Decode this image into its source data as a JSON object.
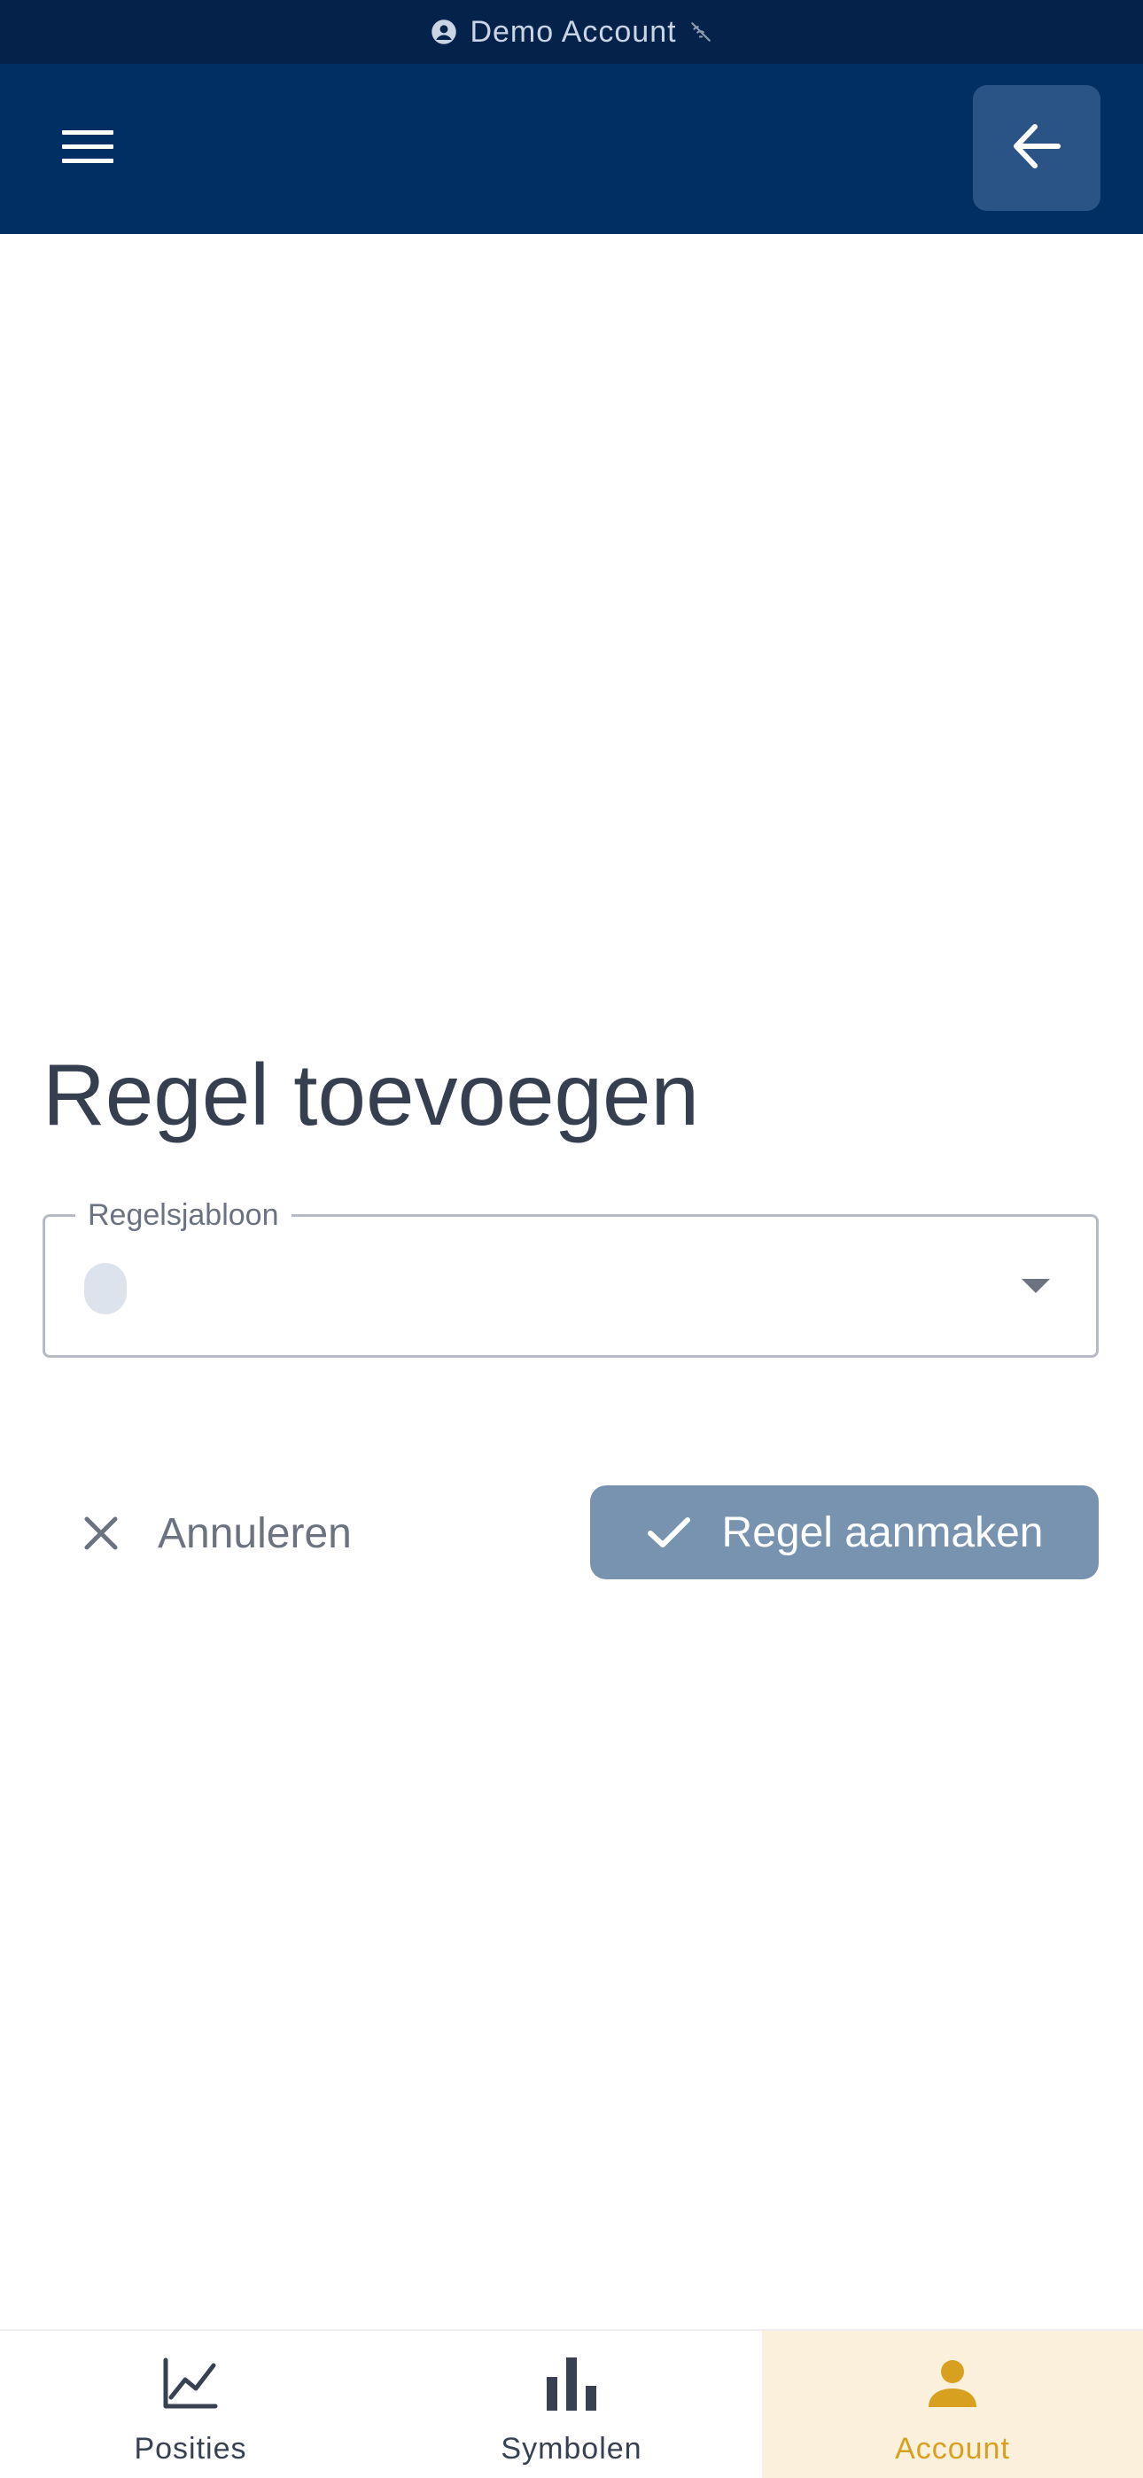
{
  "status_bar": {
    "account_label": "Demo Account",
    "account_icon": "account-circle-icon",
    "status_icon": "wifi-off-icon"
  },
  "header": {
    "menu_icon": "hamburger-menu-icon",
    "back_icon": "arrow-left-icon"
  },
  "form": {
    "title": "Regel toevoegen",
    "template_field": {
      "label": "Regelsjabloon",
      "value": "",
      "dropdown_icon": "caret-down-icon"
    },
    "cancel_label": "Annuleren",
    "create_label": "Regel aanmaken"
  },
  "bottom_nav": {
    "items": [
      {
        "label": "Posities",
        "icon": "line-chart-icon",
        "active": false
      },
      {
        "label": "Symbolen",
        "icon": "bar-chart-icon",
        "active": false
      },
      {
        "label": "Account",
        "icon": "person-icon",
        "active": true
      }
    ]
  },
  "colors": {
    "status_bar_bg": "#04224a",
    "header_bg": "#022f63",
    "back_button_bg": "#2b5486",
    "primary_button_bg": "#7793b0",
    "active_accent": "#d7a01f",
    "active_nav_bg": "#faf0dc"
  }
}
